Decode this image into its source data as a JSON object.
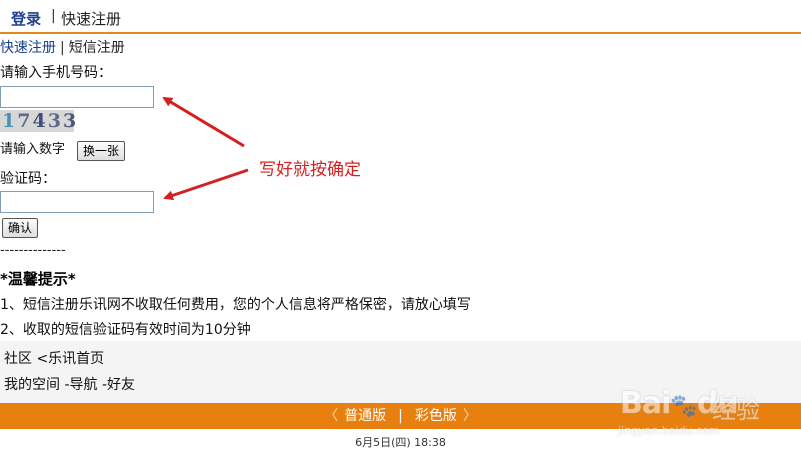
{
  "top_tabs": {
    "login": "登录",
    "separator": "|",
    "quick_register": "快速注册"
  },
  "subnav": {
    "quick_register": "快速注册",
    "separator": "|",
    "sms_register": "短信注册"
  },
  "form": {
    "phone_label": "请输入手机号码：",
    "phone_value": "",
    "captcha_digits": [
      "1",
      "7",
      "4",
      "3",
      "3"
    ],
    "captcha_prompt": "请输入数字",
    "change_button": "换一张",
    "code_label": "验证码：",
    "code_value": "",
    "confirm_button": "确认"
  },
  "divider": "--------------",
  "tips": {
    "title": "*温馨提示*",
    "items": [
      "1、短信注册乐讯网不收取任何费用，您的个人信息将严格保密，请放心填写",
      "2、收取的短信验证码有效时间为10分钟"
    ]
  },
  "community": {
    "row1": "社区 <乐讯首页",
    "row2": "我的空间 -导航 -好友"
  },
  "footer": {
    "left_arrow": "〈",
    "normal_version": "普通版",
    "separator": "|",
    "color_version": "彩色版",
    "right_arrow": "〉",
    "timestamp": "6月5日(四) 18:38"
  },
  "annotation": {
    "text": "写好就按确定",
    "color": "#d42020"
  },
  "watermark": {
    "brand": "Bai",
    "brand2": "du",
    "jingyan_cn": "经验",
    "url": "jingyan.baidu.com"
  },
  "colors": {
    "accent_orange": "#e8800f",
    "link_blue": "#1a3f8f"
  }
}
